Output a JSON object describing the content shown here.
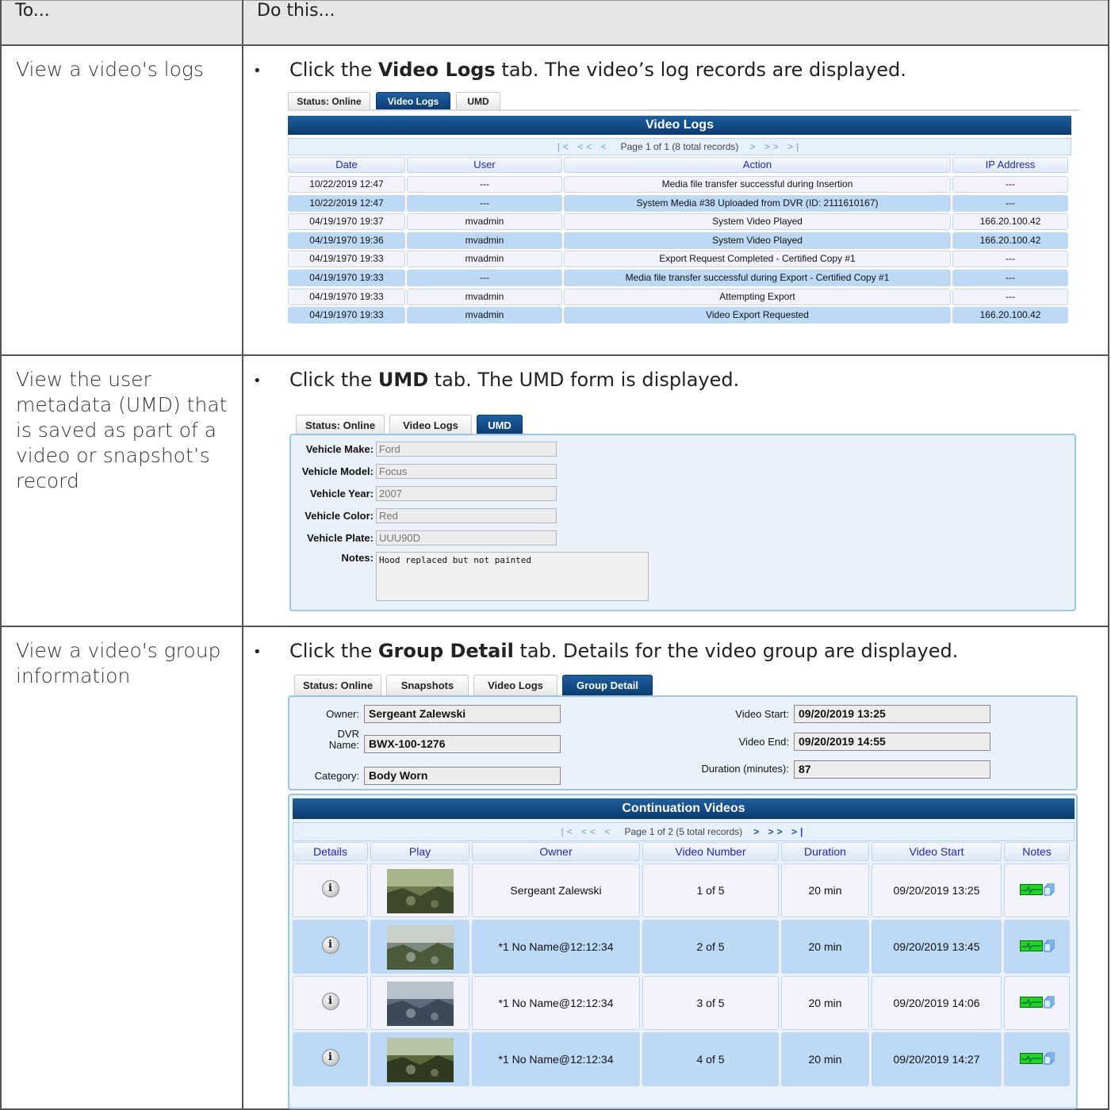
{
  "header": {
    "col1": "To...",
    "col2": "Do this..."
  },
  "rows": [
    {
      "task": "View a video's logs",
      "pre": "Click the ",
      "bold": "Video Logs",
      "post": " tab. The video’s log records are displayed."
    },
    {
      "task": "View the user metadata (UMD) that is saved as part of a video or snapshot’s record",
      "pre": "Click the ",
      "bold": "UMD",
      "post": " tab. The UMD form is displayed."
    },
    {
      "task": "View a video's group information",
      "pre": "Click the ",
      "bold": "Group Detail",
      "post": " tab. Details for the video group are displayed."
    }
  ],
  "logs": {
    "tabs": [
      "Status: Online",
      "Video Logs",
      "UMD"
    ],
    "title": "Video Logs",
    "pager": "Page 1 of 1 (8 total records)",
    "columns": [
      "Date",
      "User",
      "Action",
      "IP Address"
    ],
    "records": [
      [
        "10/22/2019 12:47",
        "---",
        "Media file transfer successful during Insertion",
        "---"
      ],
      [
        "10/22/2019 12:47",
        "---",
        "System Media #38 Uploaded from DVR (ID: 2111610167)",
        "---"
      ],
      [
        "04/19/1970 19:37",
        "mvadmin",
        "System Video Played",
        "166.20.100.42"
      ],
      [
        "04/19/1970 19:36",
        "mvadmin",
        "System Video Played",
        "166.20.100.42"
      ],
      [
        "04/19/1970 19:33",
        "mvadmin",
        "Export Request Completed - Certified Copy #1",
        "---"
      ],
      [
        "04/19/1970 19:33",
        "---",
        "Media file transfer successful during Export - Certified Copy #1",
        "---"
      ],
      [
        "04/19/1970 19:33",
        "mvadmin",
        "Attempting Export",
        "---"
      ],
      [
        "04/19/1970 19:33",
        "mvadmin",
        "Video Export Requested",
        "166.20.100.42"
      ]
    ]
  },
  "umd": {
    "tabs": [
      "Status: Online",
      "Video Logs",
      "UMD"
    ],
    "fields": [
      {
        "label": "Vehicle Make:",
        "value": "Ford"
      },
      {
        "label": "Vehicle Model:",
        "value": "Focus"
      },
      {
        "label": "Vehicle Year:",
        "value": "2007"
      },
      {
        "label": "Vehicle Color:",
        "value": "Red"
      },
      {
        "label": "Vehicle Plate:",
        "value": "UUU90D"
      }
    ],
    "notes_label": "Notes:",
    "notes_value": "Hood replaced but not painted"
  },
  "group": {
    "tabs": [
      "Status: Online",
      "Snapshots",
      "Video Logs",
      "Group Detail"
    ],
    "owner_label": "Owner:",
    "owner_value": "Sergeant Zalewski",
    "dvr_label_1": "DVR",
    "dvr_label_2": "Name:",
    "dvr_value": "BWX-100-1276",
    "category_label": "Category:",
    "category_value": "Body Worn",
    "start_label": "Video Start:",
    "start_value": "09/20/2019 13:25",
    "end_label": "Video End:",
    "end_value": "09/20/2019 14:55",
    "duration_label": "Duration (minutes):",
    "duration_value": "87",
    "cont_title": "Continuation Videos",
    "cont_pager": "Page 1 of 2 (5 total records)",
    "columns": [
      "Details",
      "Play",
      "Owner",
      "Video Number",
      "Duration",
      "Video Start",
      "Notes"
    ],
    "videos": [
      {
        "owner": "Sergeant Zalewski",
        "number": "1 of 5",
        "duration": "20 min",
        "start": "09/20/2019 13:25"
      },
      {
        "owner": "*1 No Name@12:12:34",
        "number": "2 of 5",
        "duration": "20 min",
        "start": "09/20/2019 13:45"
      },
      {
        "owner": "*1 No Name@12:12:34",
        "number": "3 of 5",
        "duration": "20 min",
        "start": "09/20/2019 14:06"
      },
      {
        "owner": "*1 No Name@12:12:34",
        "number": "4 of 5",
        "duration": "20 min",
        "start": "09/20/2019 14:27"
      }
    ]
  },
  "colors": {
    "tab_active": "#0c3d72",
    "row_alt": "#bcd9f5",
    "header_link": "#2323c8"
  }
}
